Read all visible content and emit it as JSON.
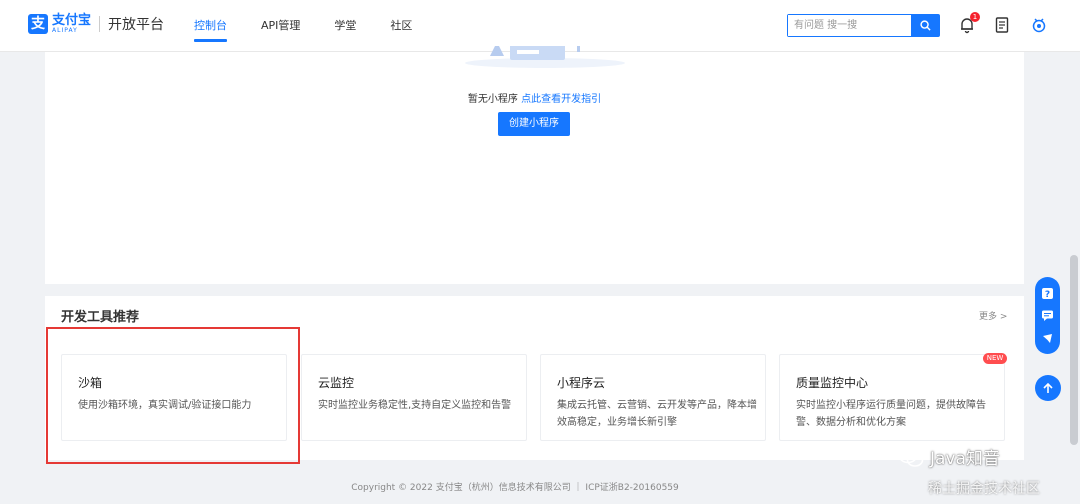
{
  "header": {
    "logo_cn": "支付宝",
    "logo_en": "ALIPAY",
    "platform_name": "开放平台",
    "nav": [
      {
        "label": "控制台",
        "active": true
      },
      {
        "label": "API管理",
        "active": false
      },
      {
        "label": "学堂",
        "active": false
      },
      {
        "label": "社区",
        "active": false
      }
    ],
    "search_placeholder": "有问题 搜一搜",
    "notification_count": "1",
    "icons": [
      "search-icon",
      "bell-icon",
      "document-icon",
      "settings-icon"
    ]
  },
  "main": {
    "empty_text": "暂无小程序",
    "empty_link": "点此查看开发指引",
    "create_button": "创建小程序"
  },
  "tools": {
    "title": "开发工具推荐",
    "more": "更多 >",
    "items": [
      {
        "name": "沙箱",
        "desc": "使用沙箱环境，真实调试/验证接口能力",
        "new": false
      },
      {
        "name": "云监控",
        "desc": "实时监控业务稳定性,支持自定义监控和告警",
        "new": false
      },
      {
        "name": "小程序云",
        "desc": "集成云托管、云营销、云开发等产品，降本增效高稳定，业务增长新引擎",
        "new": false
      },
      {
        "name": "质量监控中心",
        "desc": "实时监控小程序运行质量问题，提供故障告警、数据分析和优化方案",
        "new": true
      }
    ],
    "new_badge": "NEW"
  },
  "footer": {
    "text": "Copyright © 2022 支付宝（杭州）信息技术有限公司 ｜ ICP证浙B2-20160559"
  },
  "watermark": {
    "main": "Java知音",
    "sub": "稀土掘金技术社区"
  },
  "colors": {
    "accent": "#1677ff",
    "highlight": "#e53935",
    "new_badge": "#ff4d4f"
  }
}
